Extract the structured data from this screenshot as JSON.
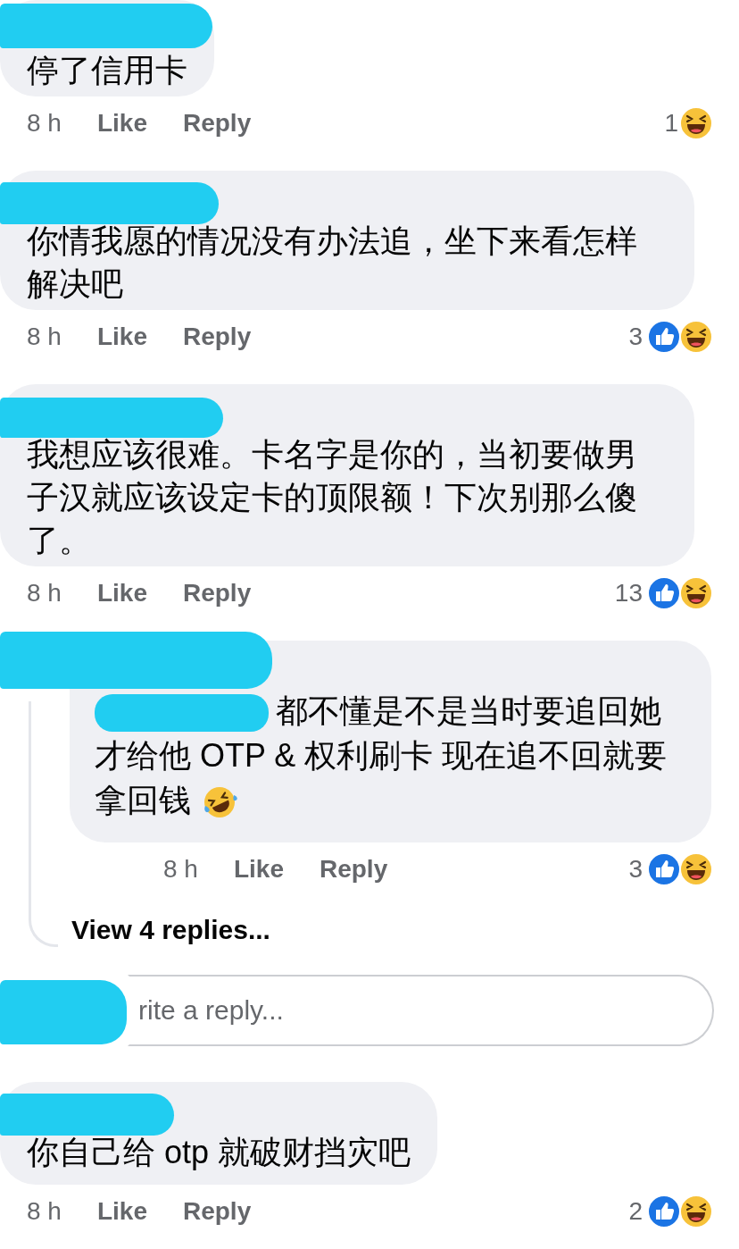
{
  "items": [
    {
      "kind": "comment",
      "author_hidden": true,
      "text": "停了信用卡",
      "time": "8 h",
      "like": "Like",
      "reply": "Reply",
      "reaction_count": "1",
      "like_reaction": false,
      "haha_reaction": true
    },
    {
      "kind": "comment",
      "author_hidden": true,
      "text": "你情我愿的情况没有办法追，坐下来看怎样解决吧",
      "time": "8 h",
      "like": "Like",
      "reply": "Reply",
      "reaction_count": "3",
      "like_reaction": true,
      "haha_reaction": true
    },
    {
      "kind": "comment",
      "author_hidden": true,
      "text": "我想应该很难。卡名字是你的，当初要做男子汉就应该设定卡的顶限额！下次别那么傻了。",
      "time": "8 h",
      "like": "Like",
      "reply": "Reply",
      "reaction_count": "13",
      "like_reaction": true,
      "haha_reaction": true
    },
    {
      "kind": "reply",
      "author_hidden": true,
      "mention_hidden": true,
      "text": "都不懂是不是当时要追回她才给他 OTP & 权利刷卡 现在追不回就要",
      "last_line": "拿回钱",
      "has_emoji": true,
      "time": "8 h",
      "like": "Like",
      "reply": "Reply",
      "reaction_count": "3",
      "like_reaction": true,
      "haha_reaction": true
    },
    {
      "kind": "view_replies",
      "label": "View 4 replies..."
    },
    {
      "kind": "reply_box",
      "author_hidden": true,
      "placeholder": "rite a reply..."
    },
    {
      "kind": "comment",
      "author_hidden": true,
      "text": "你自己给 otp 就破财挡灾吧",
      "time": "8 h",
      "like": "Like",
      "reply": "Reply",
      "reaction_count": "2",
      "like_reaction": true,
      "haha_reaction": true
    }
  ]
}
